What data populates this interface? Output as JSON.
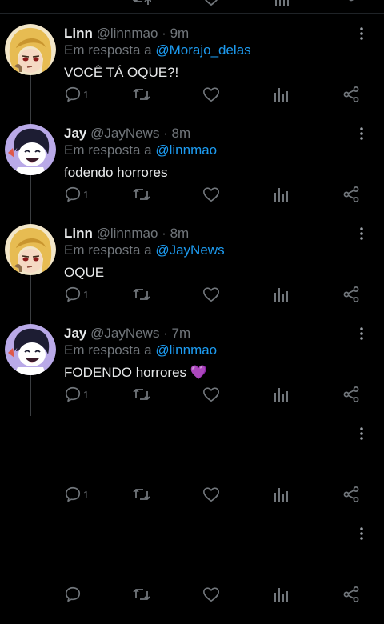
{
  "tweets": [
    {
      "name": "Linn",
      "handle": "@linnmao",
      "time": "9m",
      "reply_prefix": "Em resposta a",
      "reply_to": "@Morajo_delas",
      "text": "VOCÊ TÁ OQUE?!",
      "reply_count": "1",
      "avatar": "blonde-character-avatar"
    },
    {
      "name": "Jay",
      "handle": "@JayNews",
      "time": "8m",
      "reply_prefix": "Em resposta a",
      "reply_to": "@linnmao",
      "text": "fodendo horrores",
      "reply_count": "1",
      "avatar": "dark-hair-character-avatar"
    },
    {
      "name": "Linn",
      "handle": "@linnmao",
      "time": "8m",
      "reply_prefix": "Em resposta a",
      "reply_to": "@JayNews",
      "text": "OQUE",
      "reply_count": "1",
      "avatar": "blonde-character-avatar"
    },
    {
      "name": "Jay",
      "handle": "@JayNews",
      "time": "7m",
      "reply_prefix": "Em resposta a",
      "reply_to": "@linnmao",
      "text": "FODENDO horrores 💜",
      "reply_count": "1",
      "avatar": "dark-hair-character-avatar"
    }
  ],
  "ghost_rows": [
    {
      "reply_count": "1"
    },
    {
      "reply_count": ""
    }
  ],
  "separator": "·",
  "colors": {
    "background": "#000000",
    "text": "#e7e9ea",
    "muted": "#71767b",
    "link": "#1d9bf0",
    "thread_line": "#3a3d40"
  }
}
